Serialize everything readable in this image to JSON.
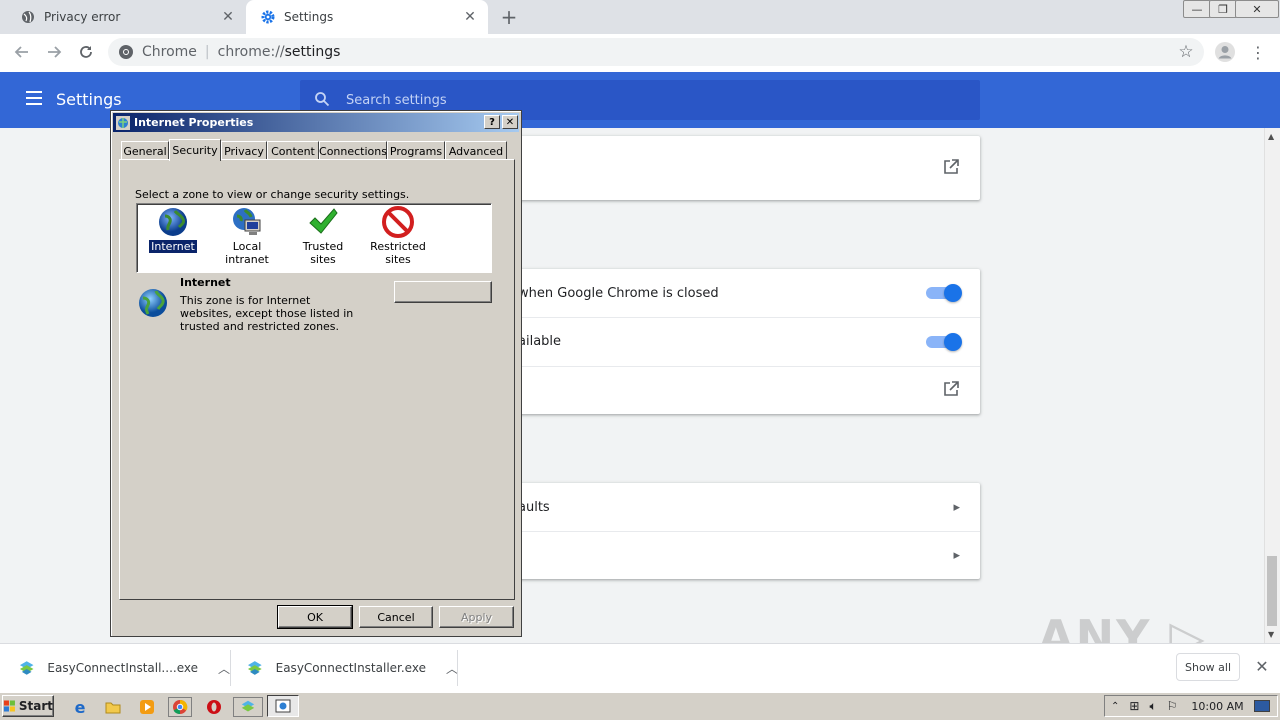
{
  "browser": {
    "tabs": [
      {
        "title": "Privacy error",
        "icon": "globe-icon"
      },
      {
        "title": "Settings",
        "icon": "gear-icon"
      }
    ],
    "omnibox": {
      "site": "Chrome",
      "url_scheme": "chrome://",
      "url_path": "settings"
    }
  },
  "settings": {
    "title": "Settings",
    "search_placeholder": "Search settings",
    "rows": {
      "background_apps": "when Google Chrome is closed",
      "hardware_accel": "ailable",
      "reset_defaults": "aults"
    },
    "accent_color": "#3367d6"
  },
  "dialog": {
    "title": "Internet Properties",
    "help_label": "?",
    "close_label": "✕",
    "tabs": [
      "General",
      "Security",
      "Privacy",
      "Content",
      "Connections",
      "Programs",
      "Advanced"
    ],
    "active_tab": "Security",
    "zone_prompt": "Select a zone to view or change security settings.",
    "zones": [
      {
        "label": "Internet",
        "icon": "globe-icon"
      },
      {
        "label": "Local intranet",
        "icon": "intranet-icon"
      },
      {
        "label": "Trusted sites",
        "icon": "checkmark-icon"
      },
      {
        "label": "Restricted sites",
        "icon": "restricted-icon"
      }
    ],
    "selected_zone": "Internet",
    "zone_name": "Internet",
    "zone_description": "This zone is for Internet websites, except those listed in trusted and restricted zones.",
    "ok_label": "OK",
    "cancel_label": "Cancel",
    "apply_label": "Apply"
  },
  "downloads": {
    "items": [
      {
        "name": "EasyConnectInstall....exe"
      },
      {
        "name": "EasyConnectInstaller.exe"
      }
    ],
    "show_all": "Show all"
  },
  "watermark": "ANY RUN",
  "taskbar": {
    "start_label": "Start",
    "clock": "10:00 AM"
  }
}
